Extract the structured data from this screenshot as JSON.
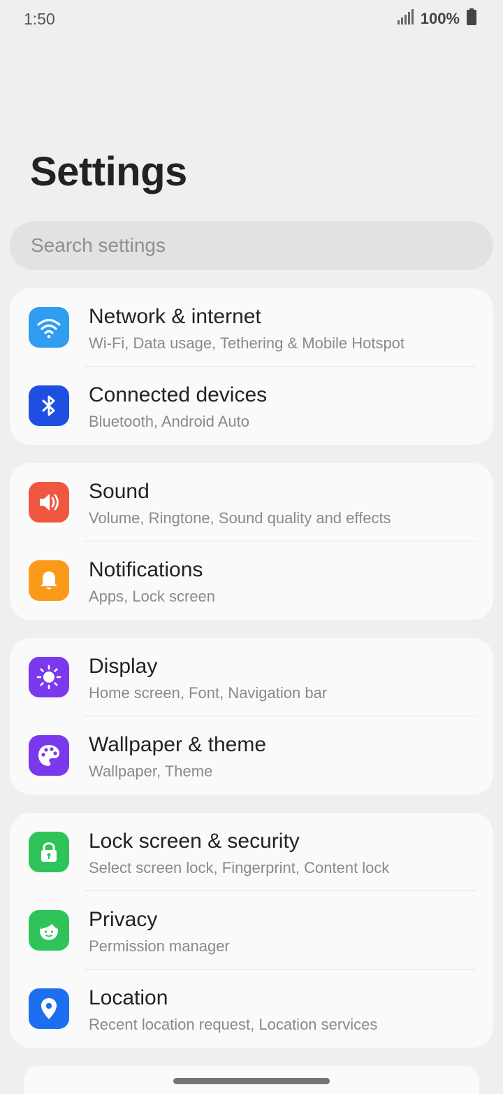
{
  "status_bar": {
    "time": "1:50",
    "battery_percent": "100%",
    "icons": [
      "signal-icon",
      "battery-icon"
    ]
  },
  "page": {
    "title": "Settings"
  },
  "search": {
    "placeholder": "Search settings"
  },
  "groups": [
    {
      "items": [
        {
          "title": "Network & internet",
          "subtitle": "Wi-Fi, Data usage, Tethering & Mobile Hotspot",
          "icon": "wifi-icon",
          "color": "#2f9df0"
        },
        {
          "title": "Connected devices",
          "subtitle": "Bluetooth, Android Auto",
          "icon": "bluetooth-icon",
          "color": "#1e4fe0"
        }
      ]
    },
    {
      "items": [
        {
          "title": "Sound",
          "subtitle": "Volume, Ringtone, Sound quality and effects",
          "icon": "speaker-icon",
          "color": "#f0573f"
        },
        {
          "title": "Notifications",
          "subtitle": "Apps, Lock screen",
          "icon": "bell-icon",
          "color": "#fb9a1a"
        }
      ]
    },
    {
      "items": [
        {
          "title": "Display",
          "subtitle": "Home screen, Font, Navigation bar",
          "icon": "sun-icon",
          "color": "#7a39ec"
        },
        {
          "title": "Wallpaper & theme",
          "subtitle": "Wallpaper, Theme",
          "icon": "palette-icon",
          "color": "#7a39ec"
        }
      ]
    },
    {
      "items": [
        {
          "title": "Lock screen & security",
          "subtitle": "Select screen lock, Fingerprint, Content lock",
          "icon": "lock-icon",
          "color": "#2ec45a"
        },
        {
          "title": "Privacy",
          "subtitle": "Permission manager",
          "icon": "privacy-face-icon",
          "color": "#2ec45a"
        },
        {
          "title": "Location",
          "subtitle": "Recent location request, Location services",
          "icon": "location-pin-icon",
          "color": "#1e6ff0"
        }
      ]
    }
  ]
}
